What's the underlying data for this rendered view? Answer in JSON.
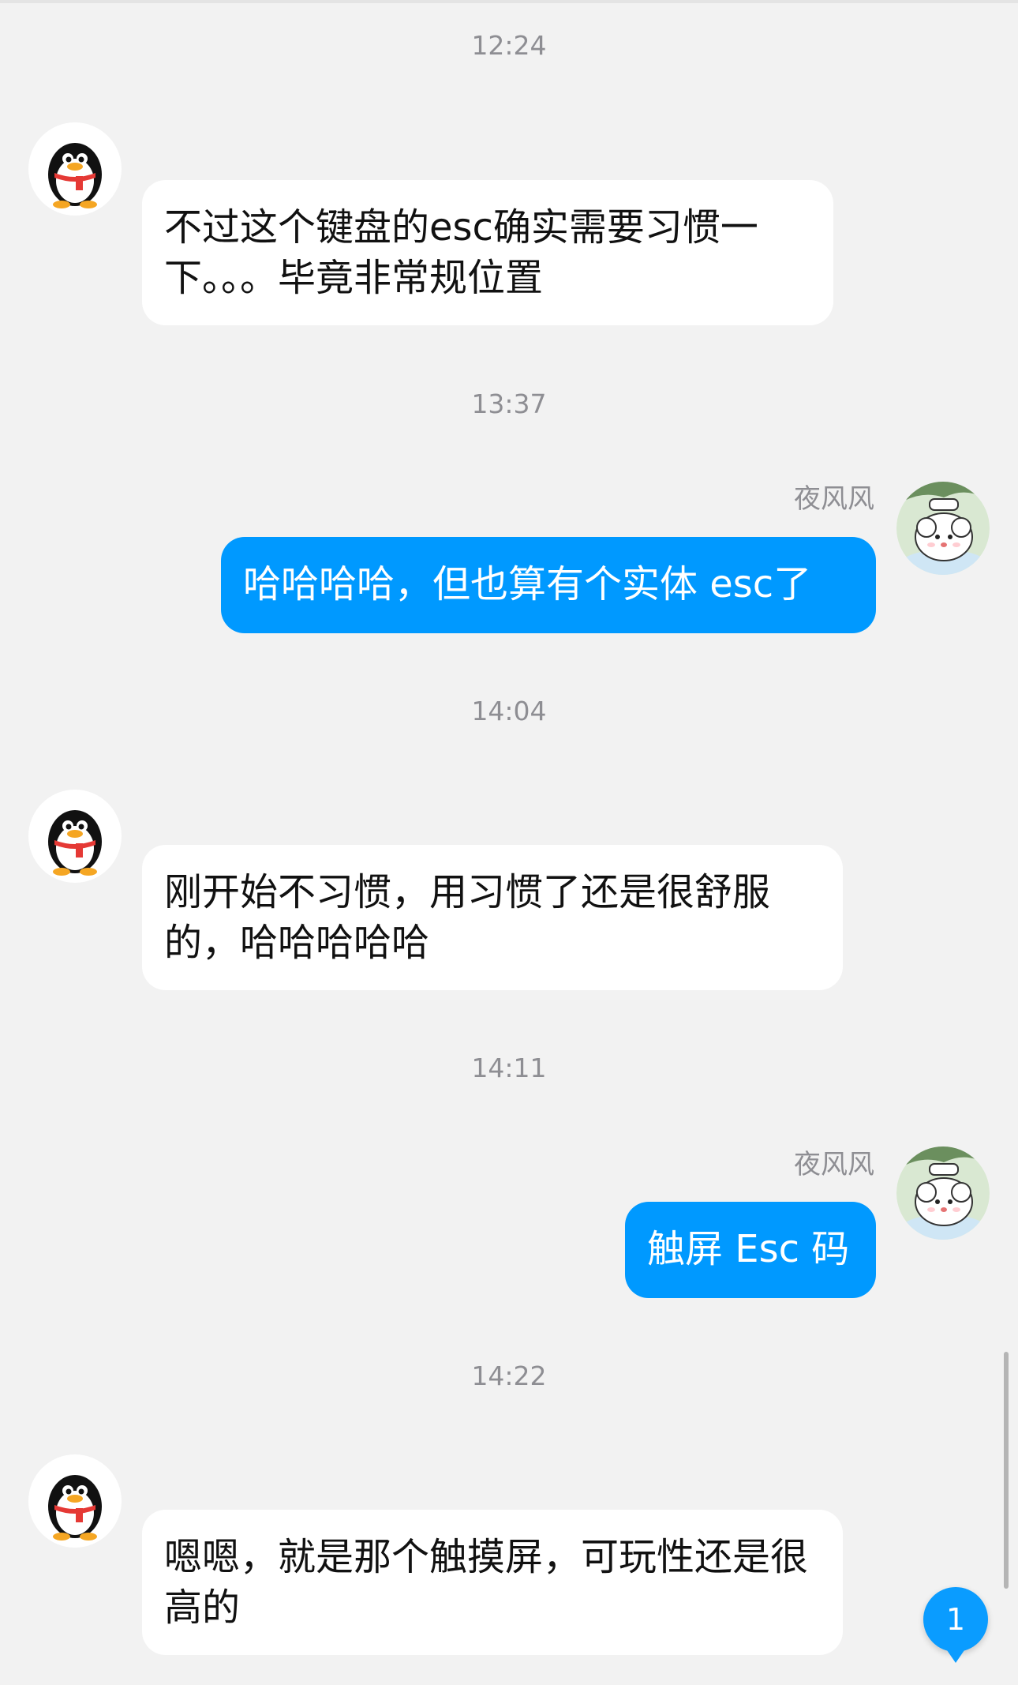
{
  "chat": {
    "messages": [
      {
        "time": "12:24",
        "direction": "incoming",
        "avatar": "qq-penguin-icon",
        "text": "不过这个键盘的esc确实需要习惯一下。。。毕竟非常规位置"
      },
      {
        "time": "13:37",
        "direction": "outgoing",
        "sender": "夜风风",
        "avatar": "user-avatar-cartoon",
        "text": "哈哈哈哈，但也算有个实体 esc了"
      },
      {
        "time": "14:04",
        "direction": "incoming",
        "avatar": "qq-penguin-icon",
        "text": "刚开始不习惯，用习惯了还是很舒服的，哈哈哈哈哈"
      },
      {
        "time": "14:11",
        "direction": "outgoing",
        "sender": "夜风风",
        "avatar": "user-avatar-cartoon",
        "text": "触屏 Esc 码"
      },
      {
        "time": "14:22",
        "direction": "incoming",
        "avatar": "qq-penguin-icon",
        "text": "嗯嗯，就是那个触摸屏，可玩性还是很高的"
      }
    ]
  },
  "unread_badge": {
    "count": "1"
  },
  "colors": {
    "background": "#f2f2f2",
    "incoming_bubble": "#ffffff",
    "outgoing_bubble": "#0099ff",
    "timestamp_text": "#8e8e93",
    "badge": "#0a9cff"
  }
}
